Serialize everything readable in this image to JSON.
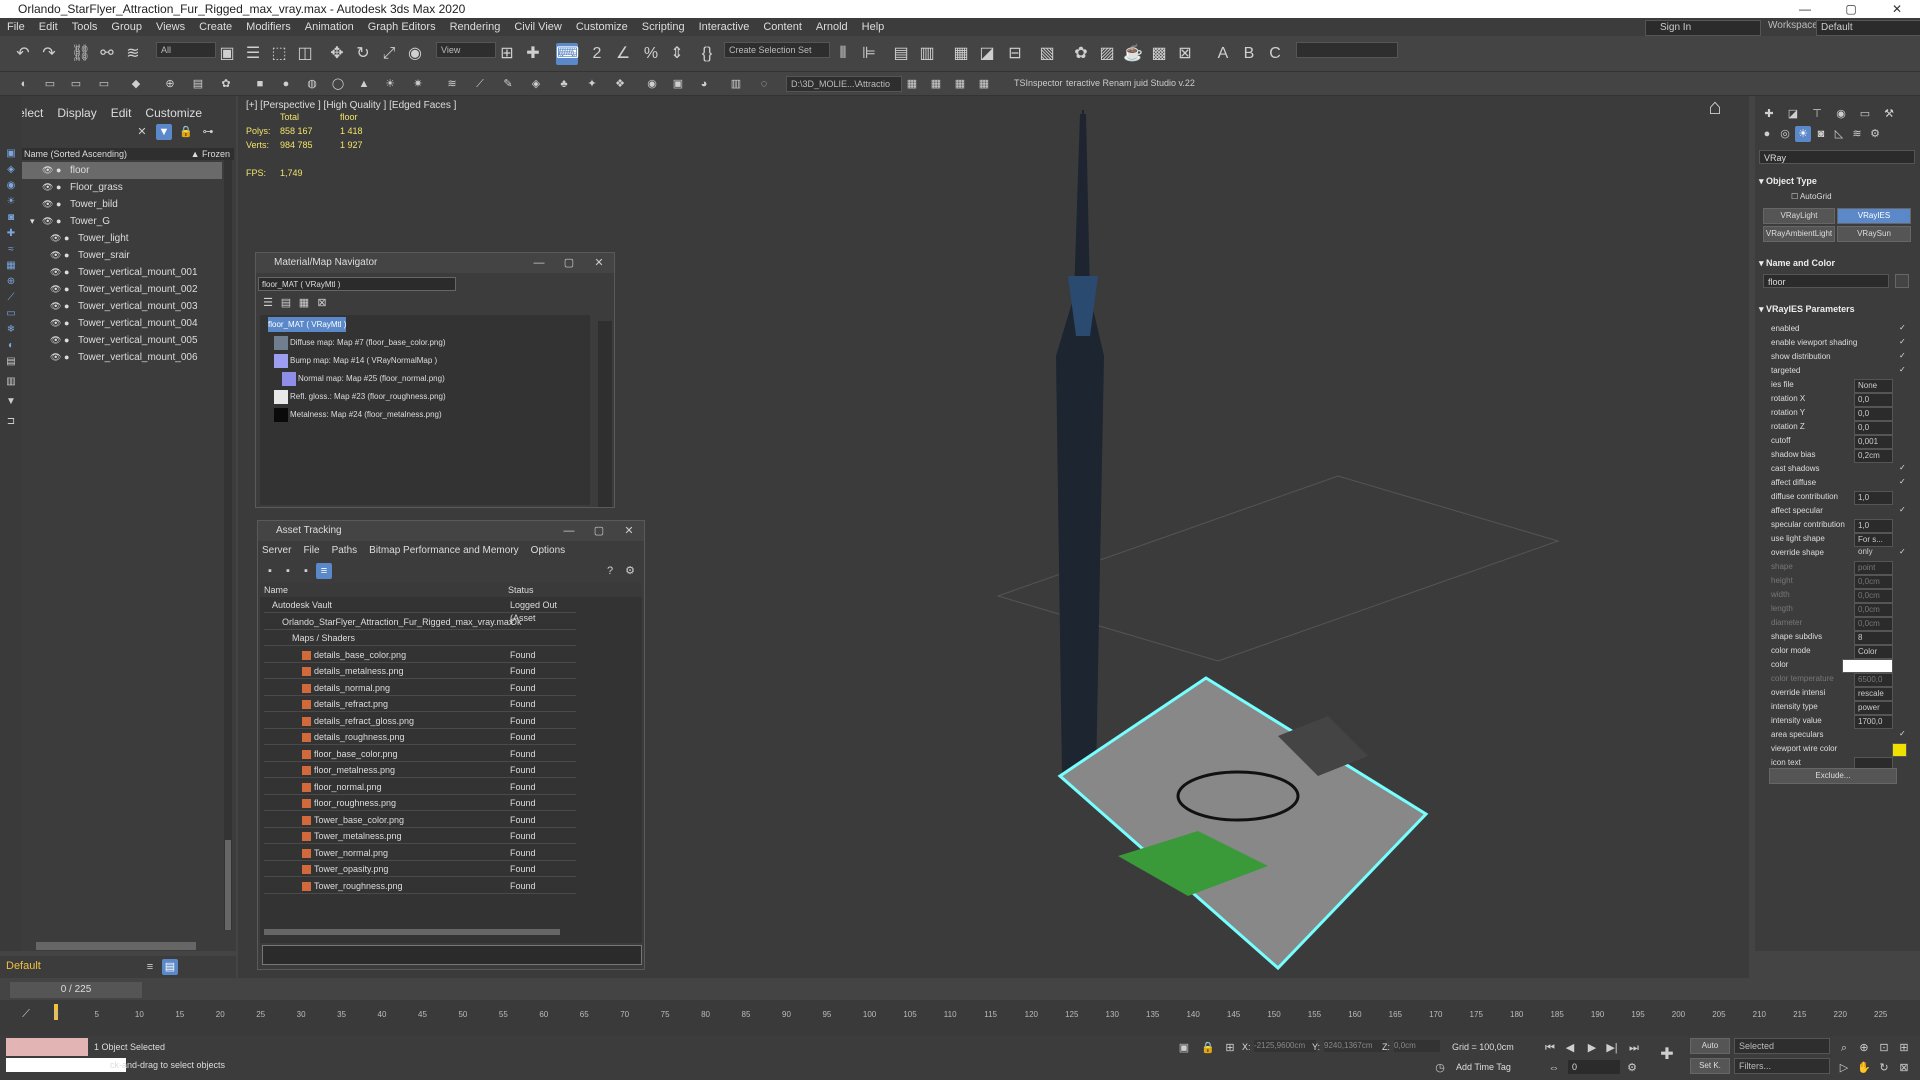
{
  "window": {
    "title": "Orlando_StarFlyer_Attraction_Fur_Rigged_max_vray.max - Autodesk 3ds Max 2020",
    "buttons": [
      "—",
      "▢",
      "✕"
    ]
  },
  "menu": [
    "File",
    "Edit",
    "Tools",
    "Group",
    "Views",
    "Create",
    "Modifiers",
    "Animation",
    "Graph Editors",
    "Rendering",
    "Civil View",
    "Customize",
    "Scripting",
    "Interactive",
    "Content",
    "Arnold",
    "Help"
  ],
  "account": {
    "signin": "Sign In",
    "workspaces_label": "Workspaces:",
    "workspace": "Default"
  },
  "toolbar": {
    "selection_filter": "All",
    "ref_coord": "View",
    "named_selection": "Create Selection Set",
    "path_dropdown": "D:\\3D_MOLIE...\\Attractio",
    "tsinspector": "TSInspector",
    "renamer": "teractive Renam juid Studio v.22"
  },
  "scene_explorer": {
    "tabs": [
      "Select",
      "Display",
      "Edit",
      "Customize"
    ],
    "column_header": "Name (Sorted Ascending)",
    "frozen_header": "▲ Frozen",
    "items": [
      {
        "name": "floor",
        "selected": true
      },
      {
        "name": "Floor_grass"
      },
      {
        "name": "Tower_bild"
      },
      {
        "name": "Tower_G"
      },
      {
        "name": "Tower_light"
      },
      {
        "name": "Tower_srair"
      },
      {
        "name": "Tower_vertical_mount_001"
      },
      {
        "name": "Tower_vertical_mount_002"
      },
      {
        "name": "Tower_vertical_mount_003"
      },
      {
        "name": "Tower_vertical_mount_004"
      },
      {
        "name": "Tower_vertical_mount_005"
      },
      {
        "name": "Tower_vertical_mount_006"
      }
    ],
    "layer": "Default",
    "frame": "0 / 225"
  },
  "viewport": {
    "label": "[+] [Perspective ] [High Quality ] [Edged Faces ]",
    "stats_total_label": "Total",
    "stats_floor_label": "floor",
    "polys_label": "Polys:",
    "polys_total": "858 167",
    "polys_floor": "1 418",
    "verts_label": "Verts:",
    "verts_total": "984 785",
    "verts_floor": "1 927",
    "fps_label": "FPS:",
    "fps": "1,749"
  },
  "material_navigator": {
    "title": "Material/Map Navigator",
    "field": "floor_MAT ( VRayMtl )",
    "root": "floor_MAT ( VRayMtl )",
    "maps": [
      {
        "label": "Diffuse map: Map #7 (floor_base_color.png)",
        "color": "#6f7f8f"
      },
      {
        "label": "Bump map: Map #14 ( VRayNormalMap )",
        "color": "#9d9df2"
      },
      {
        "label": "Normal map: Map #25 (floor_normal.png)",
        "color": "#8e8ee8"
      },
      {
        "label": "Refl. gloss.: Map #23 (floor_roughness.png)",
        "color": "#e8e8e8"
      },
      {
        "label": "Metalness: Map #24 (floor_metalness.png)",
        "color": "#0a0a0a"
      }
    ]
  },
  "asset_tracking": {
    "title": "Asset Tracking",
    "menu": [
      "Server",
      "File",
      "Paths",
      "Bitmap Performance and Memory",
      "Options"
    ],
    "col_name": "Name",
    "col_status": "Status",
    "rows": [
      {
        "name": "Autodesk Vault",
        "status": "Logged Out (Asset",
        "indent": 0
      },
      {
        "name": "Orlando_StarFlyer_Attraction_Fur_Rigged_max_vray.max",
        "status": "Ok",
        "indent": 1
      },
      {
        "name": "Maps / Shaders",
        "status": "",
        "indent": 2
      },
      {
        "name": "details_base_color.png",
        "status": "Found",
        "indent": 3
      },
      {
        "name": "details_metalness.png",
        "status": "Found",
        "indent": 3
      },
      {
        "name": "details_normal.png",
        "status": "Found",
        "indent": 3
      },
      {
        "name": "details_refract.png",
        "status": "Found",
        "indent": 3
      },
      {
        "name": "details_refract_gloss.png",
        "status": "Found",
        "indent": 3
      },
      {
        "name": "details_roughness.png",
        "status": "Found",
        "indent": 3
      },
      {
        "name": "floor_base_color.png",
        "status": "Found",
        "indent": 3
      },
      {
        "name": "floor_metalness.png",
        "status": "Found",
        "indent": 3
      },
      {
        "name": "floor_normal.png",
        "status": "Found",
        "indent": 3
      },
      {
        "name": "floor_roughness.png",
        "status": "Found",
        "indent": 3
      },
      {
        "name": "Tower_base_color.png",
        "status": "Found",
        "indent": 3
      },
      {
        "name": "Tower_metalness.png",
        "status": "Found",
        "indent": 3
      },
      {
        "name": "Tower_normal.png",
        "status": "Found",
        "indent": 3
      },
      {
        "name": "Tower_opasity.png",
        "status": "Found",
        "indent": 3
      },
      {
        "name": "Tower_roughness.png",
        "status": "Found",
        "indent": 3
      }
    ]
  },
  "command_panel": {
    "category": "VRay",
    "object_type_title": "Object Type",
    "autogrid": "AutoGrid",
    "buttons": [
      "VRayLight",
      "VRayIES",
      "VRayAmbientLight",
      "VRaySun"
    ],
    "name_color_title": "Name and Color",
    "name_value": "floor",
    "params_title": "VRayIES Parameters",
    "params": [
      {
        "label": "enabled",
        "type": "check"
      },
      {
        "label": "enable viewport shading",
        "type": "check"
      },
      {
        "label": "show distribution",
        "type": "check"
      },
      {
        "label": "targeted",
        "type": "check"
      },
      {
        "label": "ies file",
        "value": "None"
      },
      {
        "label": "rotation X",
        "value": "0,0"
      },
      {
        "label": "rotation Y",
        "value": "0,0"
      },
      {
        "label": "rotation Z",
        "value": "0,0"
      },
      {
        "label": "cutoff",
        "value": "0,001"
      },
      {
        "label": "shadow bias",
        "value": "0,2cm"
      },
      {
        "label": "cast shadows",
        "type": "check"
      },
      {
        "label": "affect diffuse",
        "type": "check"
      },
      {
        "label": "diffuse contribution",
        "value": "1,0"
      },
      {
        "label": "affect specular",
        "type": "check"
      },
      {
        "label": "specular contribution",
        "value": "1,0"
      },
      {
        "label": "use light shape",
        "value": "For s... only"
      },
      {
        "label": "override shape",
        "type": "check"
      },
      {
        "label": "shape",
        "value": "point",
        "dim": true
      },
      {
        "label": "height",
        "value": "0,0cm",
        "dim": true
      },
      {
        "label": "width",
        "value": "0,0cm",
        "dim": true
      },
      {
        "label": "length",
        "value": "0,0cm",
        "dim": true
      },
      {
        "label": "diameter",
        "value": "0,0cm",
        "dim": true
      },
      {
        "label": "shape subdivs",
        "value": "8"
      },
      {
        "label": "color mode",
        "value": "Color"
      },
      {
        "label": "color",
        "value": ""
      },
      {
        "label": "color temperature",
        "value": "6500,0",
        "dim": true
      },
      {
        "label": "override intensi",
        "value": "rescale"
      },
      {
        "label": "intensity type",
        "value": "power (lm)"
      },
      {
        "label": "intensity value",
        "value": "1700,0"
      },
      {
        "label": "area speculars",
        "type": "check"
      },
      {
        "label": "viewport wire color",
        "value": ""
      },
      {
        "label": "icon text",
        "value": ""
      }
    ],
    "exclude": "Exclude..."
  },
  "timeline": {
    "ticks": [
      "0",
      "5",
      "10",
      "15",
      "20",
      "25",
      "30",
      "35",
      "40",
      "45",
      "50",
      "55",
      "60",
      "65",
      "70",
      "75",
      "80",
      "85",
      "90",
      "95",
      "100",
      "105",
      "110",
      "115",
      "120",
      "125",
      "130",
      "135",
      "140",
      "145",
      "150",
      "155",
      "160",
      "165",
      "170",
      "175",
      "180",
      "185",
      "190",
      "195",
      "200",
      "205",
      "210",
      "215",
      "220",
      "225"
    ]
  },
  "status": {
    "selected": "1 Object Selected",
    "prompt": "ck-and-drag to select objects",
    "x_label": "X:",
    "x_value": "-2125,9600cm",
    "y_label": "Y:",
    "y_value": "9240,1367cm",
    "z_label": "Z:",
    "z_value": "0,0cm",
    "grid": "Grid = 100,0cm",
    "add_time_tag": "Add Time Tag",
    "auto": "Auto",
    "set_key": "Set K.",
    "selected_dd": "Selected",
    "filters": "Filters...",
    "frame_value": "0"
  },
  "colors": {
    "accent": "#5a88c8",
    "stats_yellow": "#f3e36a",
    "viewport_wire": "#f0e000"
  }
}
